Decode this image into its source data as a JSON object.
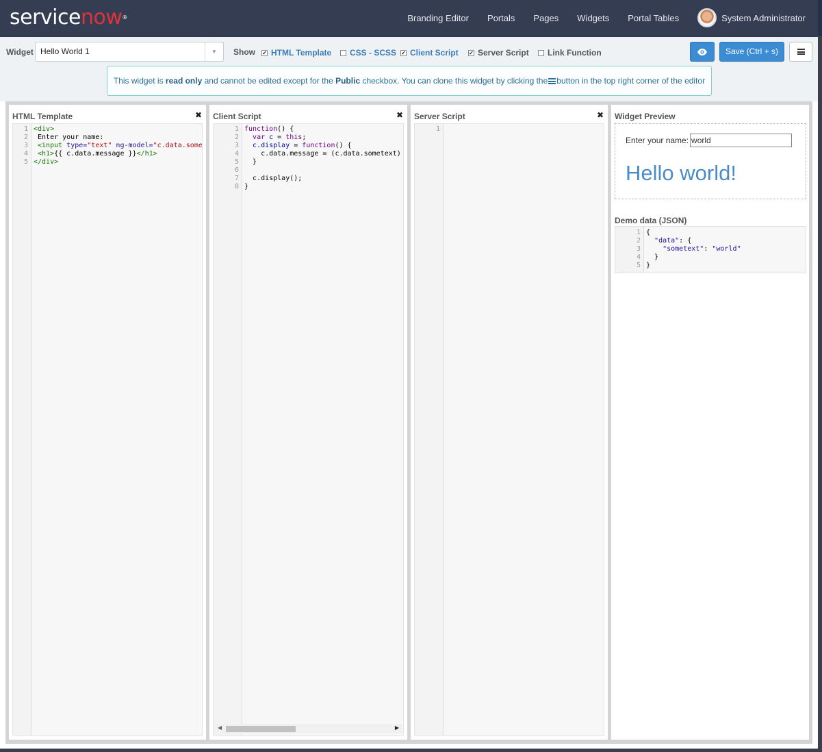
{
  "brand": {
    "text_service": "service",
    "text_now": "now",
    "mark": "®"
  },
  "nav": {
    "links": [
      "Branding Editor",
      "Portals",
      "Pages",
      "Widgets",
      "Portal Tables"
    ],
    "user_name": "System Administrator"
  },
  "toolbar": {
    "widget_label": "Widget",
    "widget_value": "Hello World 1",
    "show_label": "Show",
    "checkboxes": [
      {
        "label": "HTML Template",
        "checked": true
      },
      {
        "label": "CSS - SCSS",
        "checked": false
      },
      {
        "label": "Client Script",
        "checked": true
      },
      {
        "label": "Server Script",
        "checked": true
      },
      {
        "label": "Link Function",
        "checked": false
      }
    ],
    "save_label": "Save (Ctrl + s)",
    "preview_icon": "eye-icon",
    "menu_icon": "hamburger-icon"
  },
  "alert": {
    "part1": "This widget is ",
    "bold1": "read only",
    "part2": " and cannot be edited except for the ",
    "bold2": "Public",
    "part3": " checkbox. You can clone this widget by clicking the",
    "part4": "button in the top right corner of the editor"
  },
  "panes": {
    "html": {
      "title": "HTML Template",
      "line_numbers": [
        "1",
        "2",
        "3",
        "4",
        "5"
      ]
    },
    "client": {
      "title": "Client Script",
      "line_numbers": [
        "1",
        "2",
        "3",
        "4",
        "5",
        "6",
        "7",
        "8"
      ]
    },
    "server": {
      "title": "Server Script",
      "line_numbers": [
        "1"
      ]
    },
    "preview": {
      "title": "Widget Preview",
      "name_label": "Enter your name:",
      "name_value": "world",
      "heading": "Hello world!",
      "demo_title": "Demo data (JSON)",
      "demo_line_numbers": [
        "1",
        "2",
        "3",
        "4",
        "5"
      ]
    }
  },
  "code": {
    "html": {
      "l1": "<div>",
      "l2": " Enter your name:",
      "l3_tag_open": " <input",
      "l3_attr1": " type=",
      "l3_str1": "\"text\"",
      "l3_attr2": " ng-model=",
      "l3_str2": "\"c.data.somet",
      "l4_tag_open": " <h1>",
      "l4_text": "{{ c.data.message }}",
      "l4_tag_close": "</h1>",
      "l5": "</div>"
    },
    "client": {
      "l1_kw": "function",
      "l1_rest": "() {",
      "l2_indent": "  ",
      "l2_kw": "var",
      "l2_var": " c",
      "l2_op": " = ",
      "l2_this": "this",
      "l2_end": ";",
      "l3_prop": "  c.display",
      "l3_op": " = ",
      "l3_kw": "function",
      "l3_rest": "() {",
      "l4": "    c.data.message = (c.data.sometext)",
      "l5": "  }",
      "l6": "",
      "l7": "  c.display();",
      "l8": "}"
    },
    "demo": {
      "l1": "{",
      "l2_key": "\"data\"",
      "l2_rest": ": {",
      "l3_key": "\"sometext\"",
      "l3_sep": ": ",
      "l3_val": "\"world\"",
      "l4": "  }",
      "l5": "}"
    }
  }
}
